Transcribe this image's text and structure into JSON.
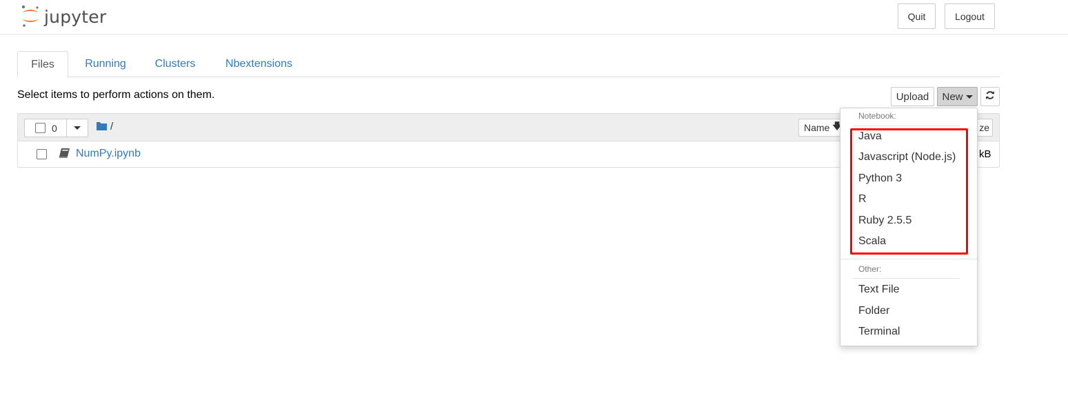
{
  "header": {
    "logo_text": "jupyter",
    "quit_label": "Quit",
    "logout_label": "Logout"
  },
  "tabs": [
    {
      "label": "Files",
      "active": true
    },
    {
      "label": "Running",
      "active": false
    },
    {
      "label": "Clusters",
      "active": false
    },
    {
      "label": "Nbextensions",
      "active": false
    }
  ],
  "toolbar": {
    "hint": "Select items to perform actions on them.",
    "upload_label": "Upload",
    "new_label": "New",
    "refresh_icon": "refresh-icon"
  },
  "file_list": {
    "selected_count": "0",
    "breadcrumb": "/",
    "sort_name_label": "Name",
    "last_modified_partial": "ze",
    "rows": [
      {
        "name": "NumPy.ipynb",
        "size_partial": "kB",
        "icon": "notebook-icon"
      }
    ]
  },
  "new_menu": {
    "notebook_header": "Notebook:",
    "kernels": [
      "Java",
      "Javascript (Node.js)",
      "Python 3",
      "R",
      "Ruby 2.5.5",
      "Scala"
    ],
    "other_header": "Other:",
    "other_items": [
      "Text File",
      "Folder",
      "Terminal"
    ]
  },
  "colors": {
    "link": "#337ab7",
    "jupyter_orange": "#f37726",
    "highlight": "#ff0000"
  }
}
